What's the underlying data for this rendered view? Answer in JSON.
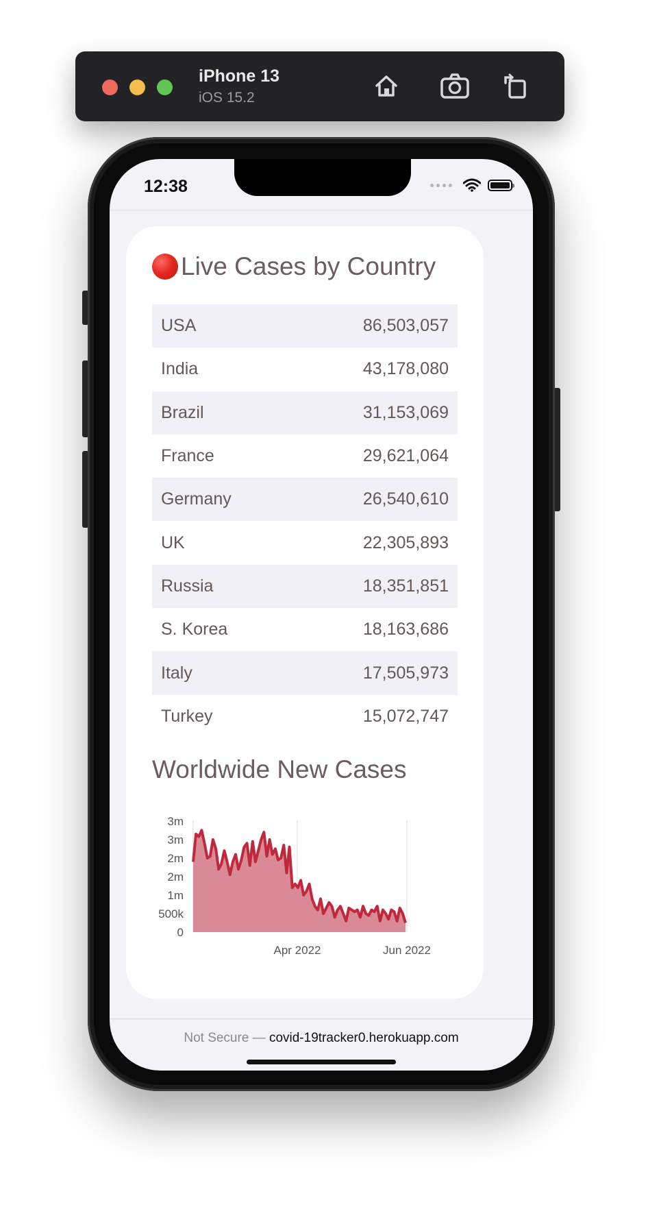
{
  "simulator": {
    "device_name": "iPhone 13",
    "os_version": "iOS 15.2",
    "icons": [
      "home-icon",
      "screenshot-icon",
      "rotate-icon"
    ]
  },
  "status_bar": {
    "time": "12:38"
  },
  "card": {
    "title": "Live Cases by Country",
    "title_icon": "red-circle",
    "rows": [
      {
        "country": "USA",
        "cases": "86,503,057"
      },
      {
        "country": "India",
        "cases": "43,178,080"
      },
      {
        "country": "Brazil",
        "cases": "31,153,069"
      },
      {
        "country": "France",
        "cases": "29,621,064"
      },
      {
        "country": "Germany",
        "cases": "26,540,610"
      },
      {
        "country": "UK",
        "cases": "22,305,893"
      },
      {
        "country": "Russia",
        "cases": "18,351,851"
      },
      {
        "country": "S. Korea",
        "cases": "18,163,686"
      },
      {
        "country": "Italy",
        "cases": "17,505,973"
      },
      {
        "country": "Turkey",
        "cases": "15,072,747"
      }
    ]
  },
  "chart_section": {
    "title": "Worldwide New Cases"
  },
  "chart_data": {
    "type": "area",
    "title": "Worldwide New Cases",
    "xlabel": "",
    "ylabel": "",
    "y_tick_labels": [
      "0",
      "500k",
      "1m",
      "2m",
      "2m",
      "3m",
      "3m"
    ],
    "x_tick_labels": [
      "Apr 2022",
      "Jun 2022"
    ],
    "ylim": [
      0,
      3000000
    ],
    "grid": "vertical lines at x ticks",
    "colors": {
      "line": "#c0293b",
      "fill": "#d98a96"
    },
    "series": [
      {
        "values": [
          1900000,
          2650000,
          2580000,
          2750000,
          2400000,
          2000000,
          2050000,
          2500000,
          2250000,
          1700000,
          1850000,
          2200000,
          1900000,
          1550000,
          1900000,
          2100000,
          1700000,
          1950000,
          2300000,
          2400000,
          1800000,
          2450000,
          1900000,
          2200000,
          2500000,
          2700000,
          2050000,
          2500000,
          2100000,
          2250000,
          1950000,
          2000000,
          2350000,
          1600000,
          2300000,
          1200000,
          1300000,
          1200000,
          1400000,
          1000000,
          1100000,
          1300000,
          900000,
          700000,
          600000,
          900000,
          500000,
          650000,
          800000,
          700000,
          400000,
          600000,
          700000,
          500000,
          300000,
          650000,
          600000,
          550000,
          600000,
          400000,
          700000,
          500000,
          450000,
          600000,
          550000,
          700000,
          300000,
          600000,
          500000,
          350000,
          600000,
          550000,
          300000,
          650000,
          500000,
          250000
        ]
      }
    ]
  },
  "url_bar": {
    "prefix": "Not Secure — ",
    "host": "covid-19tracker0.herokuapp.com"
  }
}
